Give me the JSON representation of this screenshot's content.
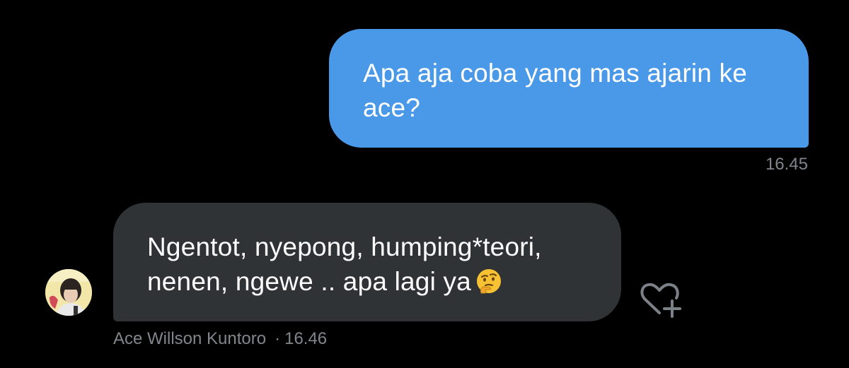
{
  "messages": {
    "outgoing": {
      "text": "Apa aja coba yang mas ajarin ke ace?",
      "time": "16.45"
    },
    "incoming": {
      "line1": "Ngentot, nyepong, humping*teori,",
      "line2": "nenen, ngewe .. apa lagi ya",
      "emoji": "thinking-face-emoji",
      "sender": "Ace Willson Kuntoro",
      "separator": "·",
      "time": "16.46"
    }
  },
  "colors": {
    "background": "#000000",
    "outgoing_bubble": "#4a98e8",
    "incoming_bubble": "#2f3336",
    "meta_text": "#80868c"
  },
  "icons": {
    "react": "heart-plus-icon",
    "avatar": "avatar"
  }
}
